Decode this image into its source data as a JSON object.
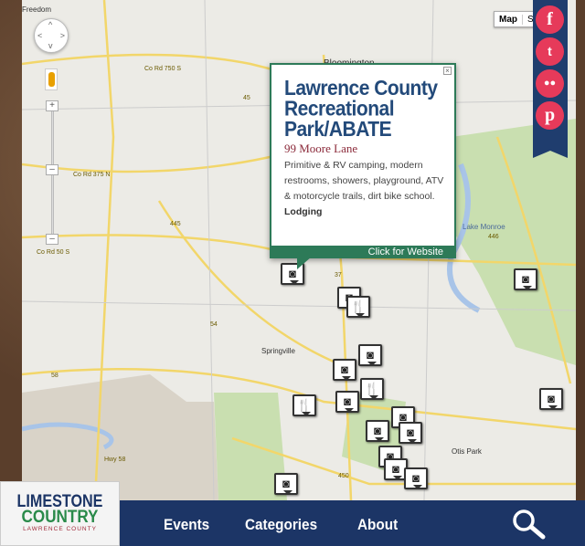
{
  "map": {
    "places": [
      "Freedom",
      "Bloomington",
      "Springville",
      "Lake Monroe",
      "Otis Park"
    ],
    "roads": [
      "Co Rd 750 S",
      "Co Rd 375 N",
      "Co Rd 50 S",
      "45",
      "445",
      "54",
      "58",
      "37",
      "446",
      "Hwy 58",
      "450"
    ],
    "map_type_options": [
      "Map",
      "Sa"
    ]
  },
  "popup": {
    "title": "Lawrence County Recreational Park/ABATE",
    "address": "99 Moore Lane",
    "description": "Primitive & RV camping, modern restrooms, showers, playground, ATV & motorcycle trails, dirt bike school.",
    "category": "Lodging",
    "website_label": "Click for Website",
    "close": "×"
  },
  "social": [
    {
      "icon": "facebook-icon",
      "glyph": "f"
    },
    {
      "icon": "twitter-icon",
      "glyph": "t"
    },
    {
      "icon": "flickr-icon",
      "glyph": "●●"
    },
    {
      "icon": "pinterest-icon",
      "glyph": "p"
    }
  ],
  "logo": {
    "line1": "LIMESTONE",
    "line2": "COUNTRY",
    "line3": "LAWRENCE COUNTY"
  },
  "nav": {
    "events": "Events",
    "categories": "Categories",
    "about": "About"
  },
  "colors": {
    "nav": "#1c3566",
    "popup_accent": "#2d7a58",
    "social": "#e63a5a",
    "title": "#234a7a"
  }
}
